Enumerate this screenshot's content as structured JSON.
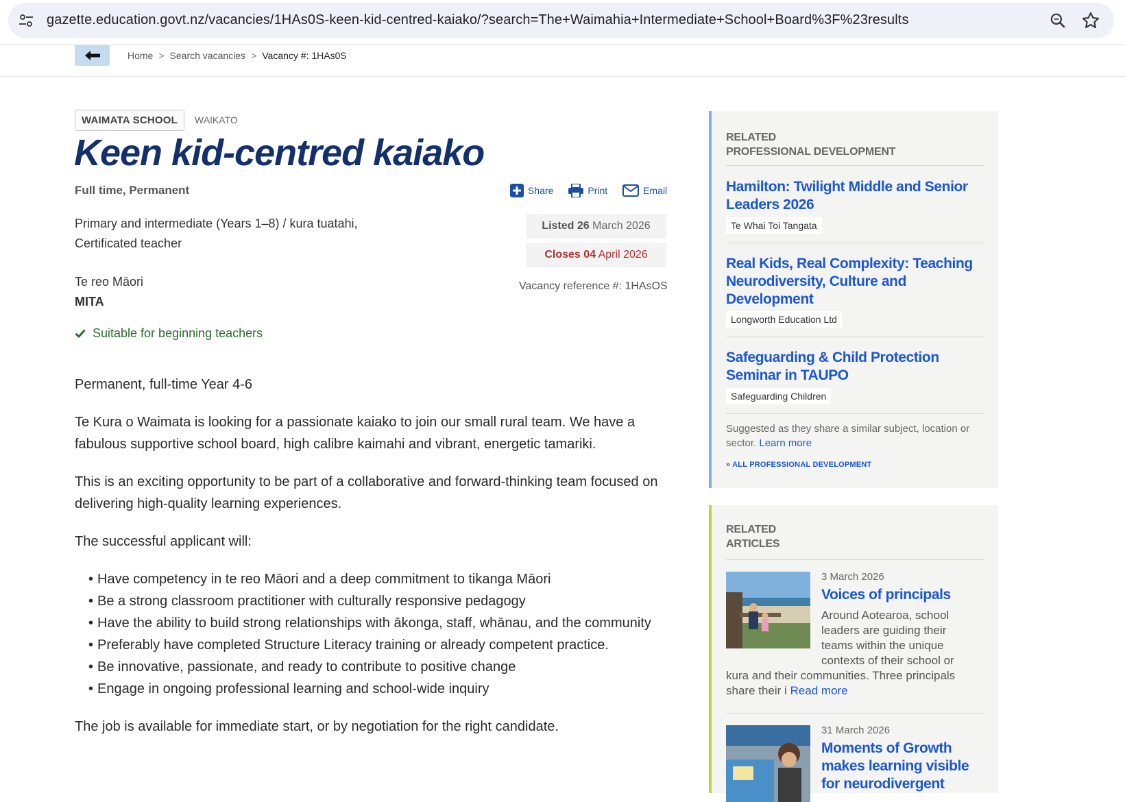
{
  "browser": {
    "url": "gazette.education.govt.nz/vacancies/1HAs0S-keen-kid-centred-kaiako/?search=The+Waimahia+Intermediate+School+Board%3F%23results"
  },
  "breadcrumb": {
    "items": [
      "Home",
      "Search vacancies",
      "Vacancy #: 1HAs0S"
    ]
  },
  "vacancy": {
    "school": "WAIMATA SCHOOL",
    "region": "WAIKATO",
    "title": "Keen kid-centred kaiako",
    "employment": "Full time, Permanent",
    "subject_line1": "Primary and intermediate (Years 1–8) / kura tuatahi,",
    "subject_line2": "Certificated teacher",
    "language_label": "Te reo Māori",
    "language_value": "MITA",
    "beginning": "Suitable for beginning teachers",
    "listed_label": "Listed",
    "listed_day": "26",
    "listed_rest": "March 2026",
    "closes_label": "Closes",
    "closes_day": "04",
    "closes_rest": "April 2026",
    "reference": "Vacancy reference #: 1HAsOS"
  },
  "actions": {
    "share": "Share",
    "print": "Print",
    "email": "Email"
  },
  "description": {
    "p1": "Permanent, full-time Year 4-6",
    "p2": "Te Kura o Waimata is looking for a passionate kaiako to join our small rural team. We have a fabulous supportive school board, high calibre kaimahi and vibrant, energetic tamariki.",
    "p3": "This is an exciting opportunity to be part of a collaborative and forward-thinking team focused on delivering high-quality learning experiences.",
    "p4": "The successful applicant will:",
    "bullets": [
      "Have competency in te reo Māori and a deep commitment to tikanga Māori",
      "Be a strong classroom practitioner with culturally responsive pedagogy",
      "Have the ability to build strong relationships with ākonga, staff, whānau, and the community",
      "Preferably have completed Structure Literacy training or already competent practice.",
      "Be innovative, passionate, and ready to contribute to positive change",
      "Engage in ongoing professional learning and school-wide inquiry"
    ],
    "p5": "The job is available for immediate start, or by negotiation for the right candidate."
  },
  "related_pd": {
    "heading1": "RELATED",
    "heading2": "PROFESSIONAL DEVELOPMENT",
    "items": [
      {
        "title": "Hamilton: Twilight Middle and Senior Leaders 2026",
        "provider": "Te Whai Toi Tangata"
      },
      {
        "title": "Real Kids, Real Complexity: Teaching Neurodiversity, Culture and Development",
        "provider": "Longworth Education Ltd"
      },
      {
        "title": "Safeguarding & Child Protection Seminar in TAUPO",
        "provider": "Safeguarding Children"
      }
    ],
    "suggest_text": "Suggested as they share a similar subject, location or sector.",
    "learn_more": "Learn more",
    "all_link": "» ALL PROFESSIONAL DEVELOPMENT"
  },
  "related_articles": {
    "heading1": "RELATED",
    "heading2": "ARTICLES",
    "items": [
      {
        "date": "3 March 2026",
        "title": "Voices of principals",
        "summary_lines": [
          "Around Aotearoa, school",
          "leaders are guiding their",
          "teams within the unique",
          "contexts of their school or"
        ],
        "summary_tail": "kura and their communities. Three principals share their i",
        "read_more": "Read more"
      },
      {
        "date": "31 March 2026",
        "title": "Moments of Growth makes learning visible for neurodivergent"
      }
    ]
  },
  "colors": {
    "title": "#13306b",
    "link": "#1a56d6",
    "closes": "#b03030",
    "beginning": "#2e6b2e",
    "pd_accent": "#7ab1e0",
    "articles_accent": "#c4cf3d"
  }
}
